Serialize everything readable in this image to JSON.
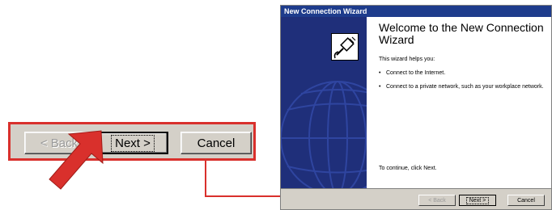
{
  "zoom": {
    "back_label": "< Back",
    "next_label": "Next >",
    "cancel_label": "Cancel"
  },
  "wizard": {
    "window_title": "New Connection Wizard",
    "heading": "Welcome to the New Connection Wizard",
    "intro": "This wizard helps you:",
    "bullets": [
      "Connect to the Internet.",
      "Connect to a private network, such as your workplace network."
    ],
    "continue_text": "To continue, click Next.",
    "back_label": "< Back",
    "next_label": "Next >",
    "cancel_label": "Cancel"
  },
  "colors": {
    "callout_red": "#d9302c",
    "titlebar_blue": "#1e3c8c",
    "side_panel_blue": "#1f2f7a",
    "dialog_gray": "#d4d0c8"
  },
  "icons": [
    "red-pointer-arrow-icon",
    "connection-plug-icon",
    "globe-watermark-icon",
    "bullet-icon"
  ]
}
